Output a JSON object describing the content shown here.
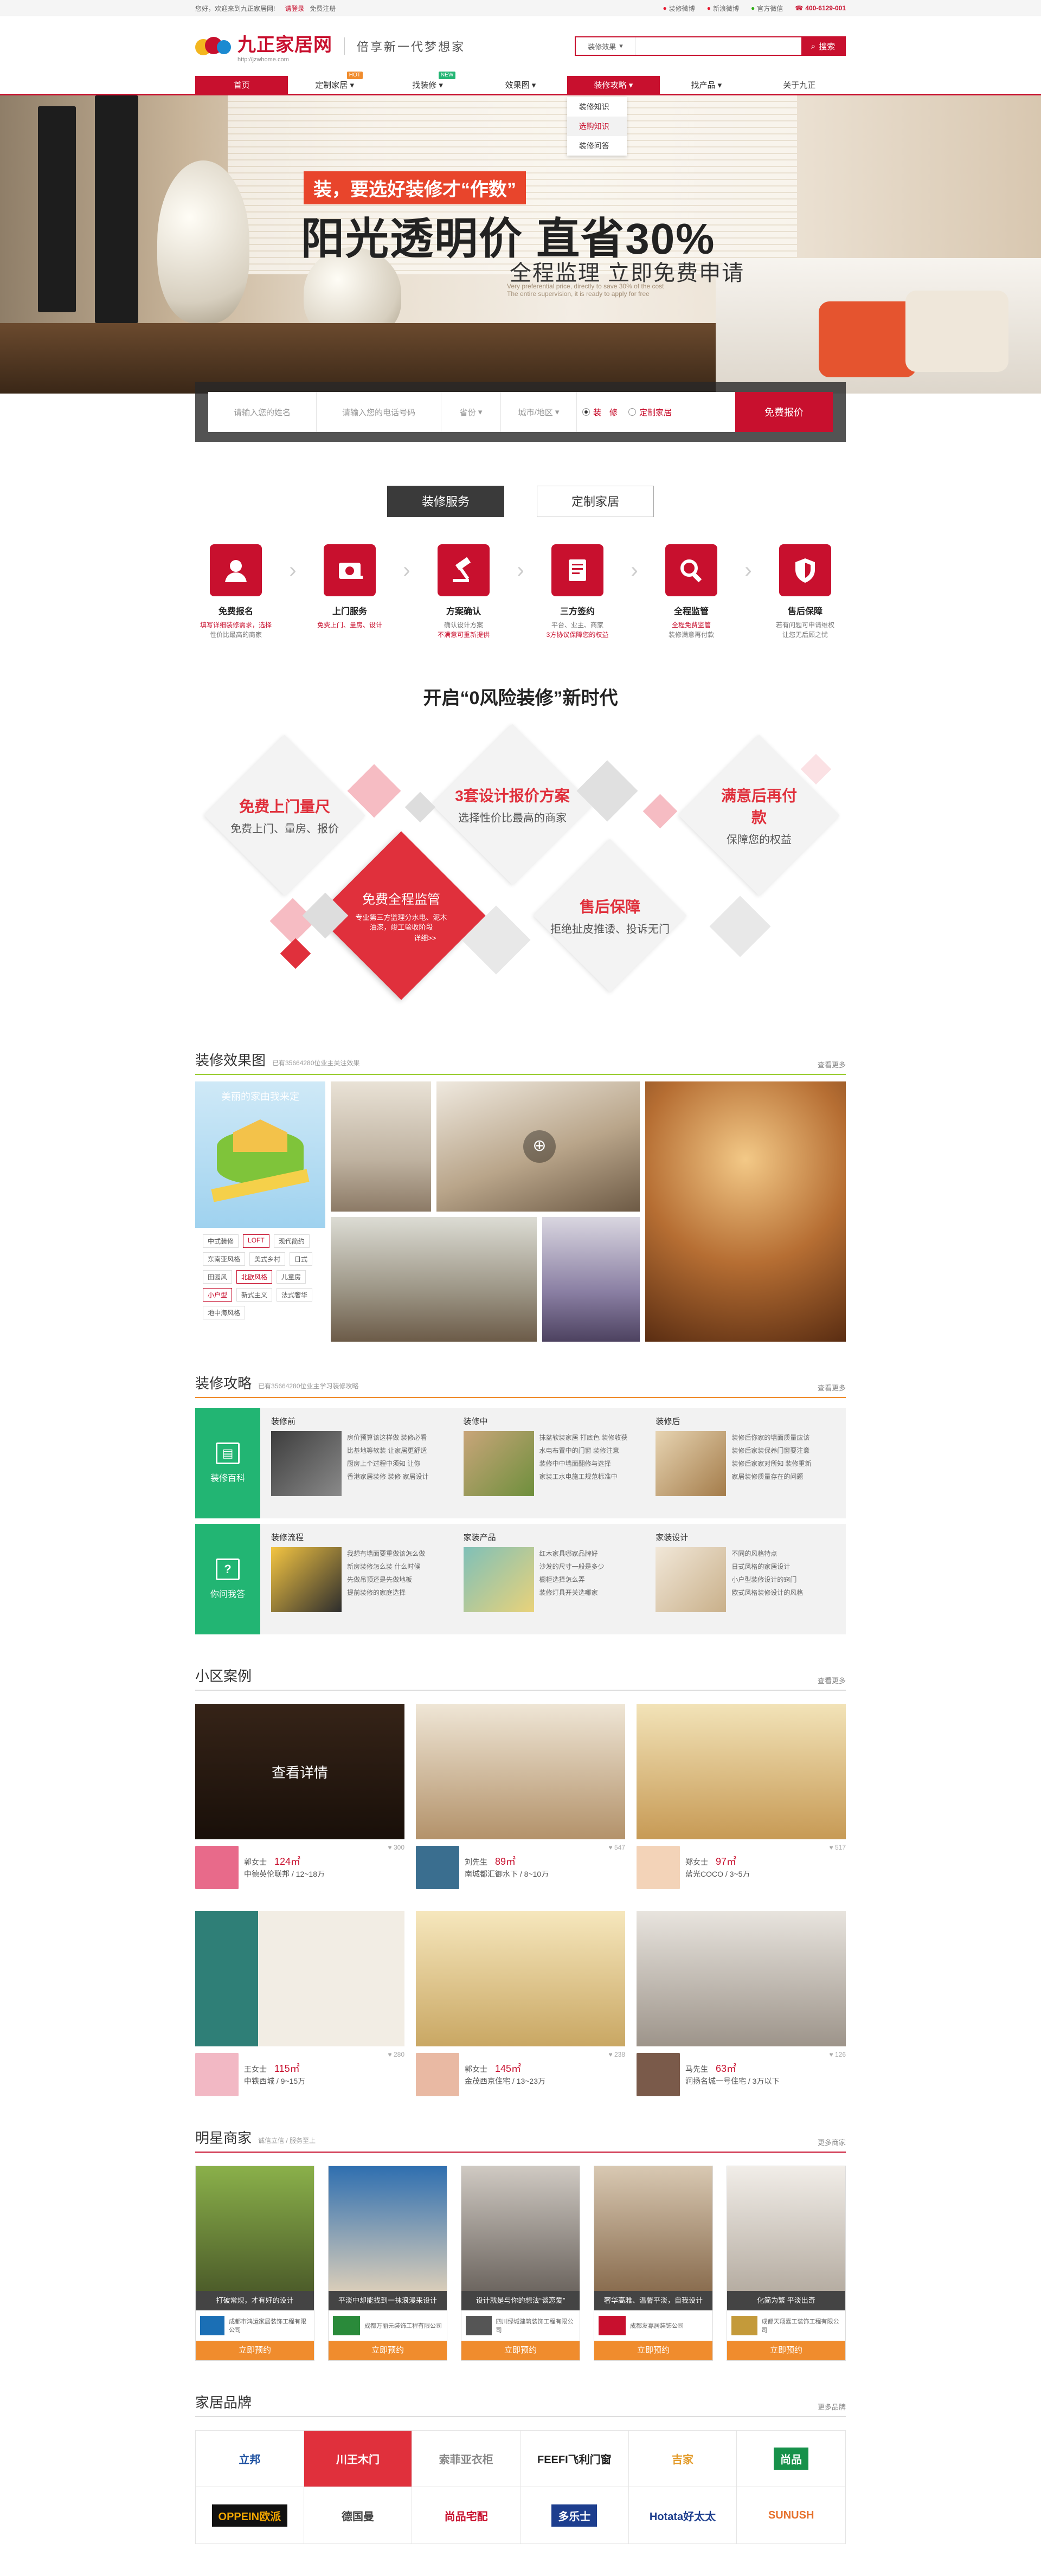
{
  "topbar": {
    "welcome": "您好，欢迎来到九正家居网!",
    "login": "请登录",
    "register": "免费注册",
    "links": [
      "装修微博",
      "新浪微博",
      "官方微信"
    ],
    "phone": "400-6129-001"
  },
  "header": {
    "logo_title": "九正家居网",
    "logo_url": "http://jzwhome.com",
    "slogan": "倍享新一代梦想家",
    "search_category": "装修效果",
    "search_placeholder": "",
    "search_button": "搜索"
  },
  "nav": {
    "items": [
      {
        "label": "首页",
        "badge": ""
      },
      {
        "label": "定制家居",
        "badge": "HOT"
      },
      {
        "label": "找装修",
        "badge": "NEW"
      },
      {
        "label": "效果图",
        "badge": ""
      },
      {
        "label": "装修攻略",
        "badge": ""
      },
      {
        "label": "找产品",
        "badge": ""
      },
      {
        "label": "关于九正",
        "badge": ""
      }
    ],
    "dropdown": [
      "装修知识",
      "选购知识",
      "装修问答"
    ]
  },
  "banner": {
    "tag": "装，要选好装修才“作数”",
    "headline": "阳光透明价 直省30%",
    "subline": "全程监理 立即免费申请",
    "small_en_1": "Very preferential price, directly to save 30% of the cost",
    "small_en_2": "The entire supervision, it is ready to apply for free"
  },
  "quote_form": {
    "name_placeholder": "请输入您的姓名",
    "phone_placeholder": "请输入您的电话号码",
    "province": "省份",
    "city": "城市/地区",
    "option_1": "装　修",
    "option_2": "定制家居",
    "submit": "免费报价"
  },
  "service_tabs": [
    "装修服务",
    "定制家居"
  ],
  "steps": [
    {
      "title": "免费报名",
      "line1": "填写详细装修需求，选择",
      "line2": "性价比最高的商家"
    },
    {
      "title": "上门服务",
      "line1": "免费上门、量房、设计",
      "line2": ""
    },
    {
      "title": "方案确认",
      "line1": "确认设计方案",
      "line2": "不满意可重新提供"
    },
    {
      "title": "三方签约",
      "line1": "平台、业主、商家",
      "line2": "3方协议保障您的权益"
    },
    {
      "title": "全程监管",
      "line1": "全程免费监管",
      "line2": "装修满意再付款"
    },
    {
      "title": "售后保障",
      "line1": "若有问题可申请维权",
      "line2": "让您无后顾之忧"
    }
  ],
  "zero_risk": {
    "heading": "开启“0风险装修”新时代",
    "blocks": [
      {
        "a": "免费上门量尺",
        "b": "免费上门、量房、报价"
      },
      {
        "a": "3套设计报价方案",
        "b": "选择性价比最高的商家"
      },
      {
        "a": "满意后再付款",
        "b": "保障您的权益"
      },
      {
        "a": "售后保障",
        "b": "拒绝扯皮推诿、投诉无门"
      }
    ],
    "center": {
      "a": "免费全程监管",
      "b1": "专业第三方监理分水电、泥木",
      "b2": "油漆，竣工验收阶段",
      "link": "详细>>"
    }
  },
  "effect": {
    "title": "装修效果图",
    "sub": "已有35664280位业主关注效果",
    "more": "查看更多",
    "cover_text": "美丽的家由我来定",
    "tags": [
      "中式装修",
      "LOFT",
      "现代简约",
      "东南亚风格",
      "美式乡村",
      "日式",
      "田园风",
      "北欧风格",
      "儿童房",
      "小户型",
      "新式主义",
      "法式奢华",
      "地中海风格"
    ],
    "highlight_tags": [
      "LOFT",
      "北欧风格",
      "小户型"
    ]
  },
  "guide": {
    "title": "装修攻略",
    "sub": "已有35664280位业主学习装修攻略",
    "more": "查看更多",
    "rows": [
      {
        "side": "装修百科",
        "cols": [
          {
            "h": "装修前",
            "items": [
              "房价预算该这样做 装修必看",
              "比基地等软装 让家居更舒适",
              "厨房上个过程中须知 让你",
              "香港家居装修 装修 家居设计"
            ]
          },
          {
            "h": "装修中",
            "items": [
              "抹盆软装家居 打底色 装修收获",
              "水电布置中的门窗 装修注意",
              "装修中中墙面翻修与选择",
              "家装工水电施工规范标准中"
            ]
          },
          {
            "h": "装修后",
            "items": [
              "装修后你家的墙面质量应该",
              "装修后家装保养门窗要注意",
              "装修后家家对所知 装修重新",
              "家居装修质量存在的问题"
            ]
          }
        ]
      },
      {
        "side": "你问我答",
        "cols": [
          {
            "h": "装修流程",
            "items": [
              "我想有墙面要重做该怎么做",
              "新房装修怎么装 什么时候",
              "先做吊顶还是先做地板",
              "提前装修的家庭选择"
            ]
          },
          {
            "h": "家装产品",
            "items": [
              "红木家具哪家品牌好",
              "沙发的尺寸一般是多少",
              "橱柜选择怎么弄",
              "装修灯具开关选哪家"
            ]
          },
          {
            "h": "家装设计",
            "items": [
              "不同的风格特点",
              "日式风格的家居设计",
              "小户型装修设计的窍门",
              "欧式风格装修设计的风格"
            ]
          }
        ]
      }
    ]
  },
  "cases": {
    "title": "小区案例",
    "more": "查看更多",
    "overlay": "查看详情",
    "items": [
      {
        "name": "郭女士",
        "area": "124㎡",
        "detail": "中德英伦联邦 / 12~18万",
        "likes": "♥ 300"
      },
      {
        "name": "刘先生",
        "area": "89㎡",
        "detail": "南城都汇御水下 / 8~10万",
        "likes": "♥ 547"
      },
      {
        "name": "郑女士",
        "area": "97㎡",
        "detail": "蓝光COCO / 3~5万",
        "likes": "♥ 517"
      },
      {
        "name": "王女士",
        "area": "115㎡",
        "detail": "中铁西城 / 9~15万",
        "likes": "♥ 280"
      },
      {
        "name": "郭女士",
        "area": "145㎡",
        "detail": "金茂西京住宅 / 13~23万",
        "likes": "♥ 238"
      },
      {
        "name": "马先生",
        "area": "63㎡",
        "detail": "润扬名城一号住宅 / 3万以下",
        "likes": "♥ 126"
      }
    ]
  },
  "merchants": {
    "title": "明星商家",
    "sub": "诚信立信 / 服务至上",
    "more": "更多商家",
    "book": "立即预约",
    "items": [
      {
        "cap": "打破常规，才有好的设计",
        "name": "成都市鸿运家居装饰工程有限公司"
      },
      {
        "cap": "平淡中却能找到一抹浪漫来设计",
        "name": "成都万丽元装饰工程有限公司"
      },
      {
        "cap": "设计就是与你的想法“谈恋爱”",
        "name": "四川绿城建筑装饰工程有限公司"
      },
      {
        "cap": "奢华高雅、温馨平淡，自我设计",
        "name": "成都友嘉居装饰公司"
      },
      {
        "cap": "化简为繁 平淡出奇",
        "name": "成都天翔嘉工装饰工程有限公司"
      }
    ]
  },
  "brands": {
    "title": "家居品牌",
    "more": "更多品牌",
    "items": [
      "立邦",
      "川王木门",
      "索菲亚衣柜",
      "FEEFI飞利门窗",
      "吉家",
      "尚品",
      "OPPEIN欧派",
      "德国曼",
      "尚品宅配",
      "多乐士",
      "Hotata好太太",
      "SUNUSH"
    ]
  }
}
